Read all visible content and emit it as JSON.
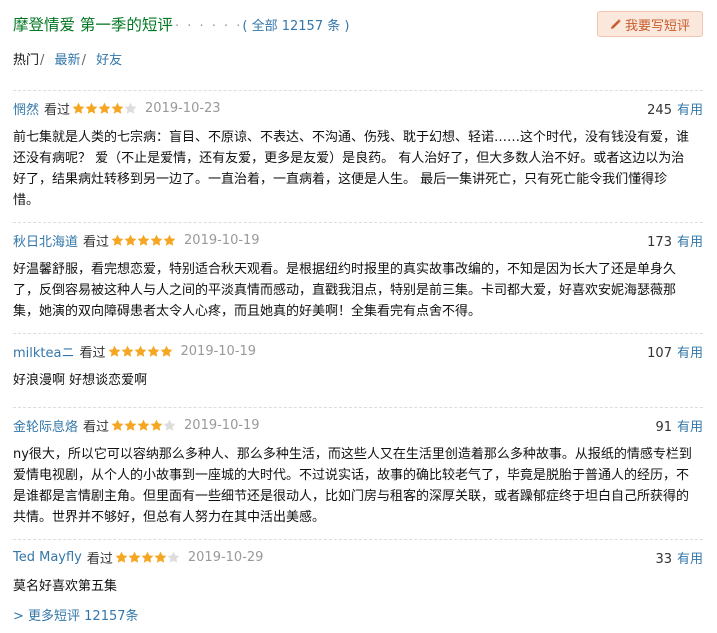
{
  "header": {
    "title": "摩登情爱 第一季的短评",
    "dots": "· · · · · ·",
    "count_label": "( 全部 12157 条 )",
    "write_button": "我要写短评",
    "colors": {
      "title": "#007722",
      "link": "#3377aa",
      "button_bg": "#fbe8dd",
      "button_text": "#c85b2c",
      "star": "#f5a623",
      "star_empty": "#dddddd"
    }
  },
  "tabs": [
    {
      "label": "热门",
      "active": true
    },
    {
      "label": "最新",
      "active": false
    },
    {
      "label": "好友",
      "active": false
    }
  ],
  "reviews": [
    {
      "user": "惘然",
      "watched": "看过",
      "rating": 4,
      "date": "2019-10-23",
      "votes": "245",
      "useful": "有用",
      "content": "前七集就是人类的七宗病：盲目、不原谅、不表达、不沟通、伤残、耽于幻想、轻诺……这个时代，没有钱没有爱，谁还没有病呢？ 爱（不止是爱情，还有友爱，更多是友爱）是良药。 有人治好了，但大多数人治不好。或者这边以为治好了，结果病灶转移到另一边了。一直治着，一直病着，这便是人生。 最后一集讲死亡，只有死亡能令我们懂得珍惜。"
    },
    {
      "user": "秋日北海道",
      "watched": "看过",
      "rating": 5,
      "date": "2019-10-19",
      "votes": "173",
      "useful": "有用",
      "content": "好温馨舒服，看完想恋爱，特别适合秋天观看。是根据纽约时报里的真实故事改编的，不知是因为长大了还是单身久了，反倒容易被这种人与人之间的平淡真情而感动，直戳我泪点，特别是前三集。卡司都大爱，好喜欢安妮海瑟薇那集，她演的双向障碍患者太令人心疼，而且她真的好美啊！全集看完有点舍不得。"
    },
    {
      "user": "milkteaニ",
      "watched": "看过",
      "rating": 5,
      "date": "2019-10-19",
      "votes": "107",
      "useful": "有用",
      "content": "好浪漫啊 好想谈恋爱啊"
    },
    {
      "user": "金轮际息烙",
      "watched": "看过",
      "rating": 4,
      "date": "2019-10-19",
      "votes": "91",
      "useful": "有用",
      "content": "ny很大，所以它可以容纳那么多种人、那么多种生活，而这些人又在生活里创造着那么多种故事。从报纸的情感专栏到爱情电视剧，从个人的小故事到一座城的大时代。不过说实话，故事的确比较老气了，毕竟是脱胎于普通人的经历，不是谁都是言情剧主角。但里面有一些细节还是很动人，比如门房与租客的深厚关联，或者躁郁症终于坦白自己所获得的共情。世界并不够好，但总有人努力在其中活出美感。"
    },
    {
      "user": "Ted Mayfly",
      "watched": "看过",
      "rating": 4,
      "date": "2019-10-29",
      "votes": "33",
      "useful": "有用",
      "content": "莫名好喜欢第五集"
    }
  ],
  "more_link": "> 更多短评 12157条"
}
